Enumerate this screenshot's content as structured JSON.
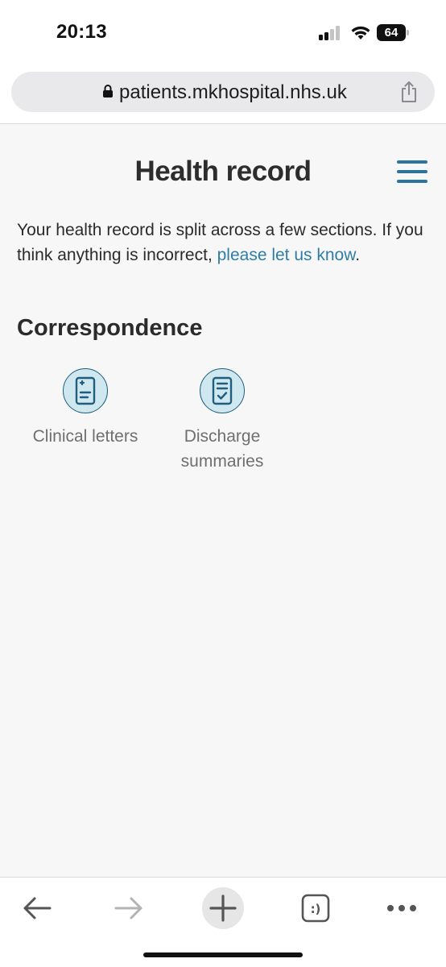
{
  "status_bar": {
    "time": "20:13",
    "battery": "64"
  },
  "browser": {
    "url": "patients.mkhospital.nhs.uk"
  },
  "page": {
    "title": "Health record",
    "intro_text": "Your health record is split across a few sections. If you think anything is incorrect, ",
    "intro_link": "please let us know",
    "intro_end": ".",
    "section_heading": "Correspondence",
    "tiles": [
      {
        "label": "Clinical letters",
        "icon": "clinical-letter-icon"
      },
      {
        "label": "Discharge summaries",
        "icon": "discharge-summary-icon"
      }
    ]
  },
  "toolbar": {
    "buttons": [
      "back-arrow-icon",
      "forward-arrow-icon",
      "plus-icon",
      "tab-switcher-icon",
      "more-icon"
    ],
    "tabs_glyph": ":)"
  },
  "colors": {
    "accent": "#2b74a0",
    "link": "#2f7da5",
    "icon_fill": "#cfe7ef",
    "icon_stroke": "#1f5f7d",
    "page_bg": "#f7f7f7"
  }
}
